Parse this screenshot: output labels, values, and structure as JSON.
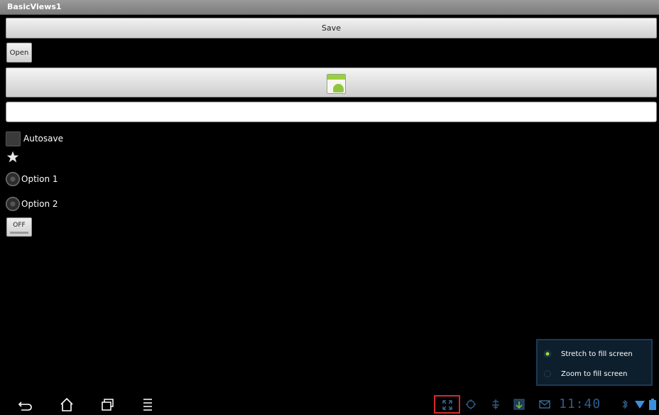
{
  "window": {
    "title": "BasicViews1"
  },
  "buttons": {
    "save_label": "Save",
    "open_label": "Open"
  },
  "text_field": {
    "value": ""
  },
  "checkbox": {
    "label": "Autosave",
    "checked": false
  },
  "radios": [
    {
      "label": "Option 1",
      "selected": false
    },
    {
      "label": "Option 2",
      "selected": false
    }
  ],
  "toggle": {
    "label": "OFF"
  },
  "compat_popup": {
    "options": [
      {
        "label": "Stretch to fill screen",
        "selected": true
      },
      {
        "label": "Zoom to fill screen",
        "selected": false
      }
    ]
  },
  "system_bar": {
    "time": "11:40",
    "icons": [
      "back-icon",
      "home-icon",
      "recent-apps-icon",
      "menu-icon",
      "screen-compat-icon",
      "gps-icon",
      "usb-debug-icon",
      "download-icon",
      "gmail-icon",
      "bluetooth-icon",
      "wifi-icon",
      "battery-icon"
    ]
  },
  "colors": {
    "accent": "#9fe03b",
    "highlight": "#d52a2a",
    "clock": "#2b5e8f"
  }
}
